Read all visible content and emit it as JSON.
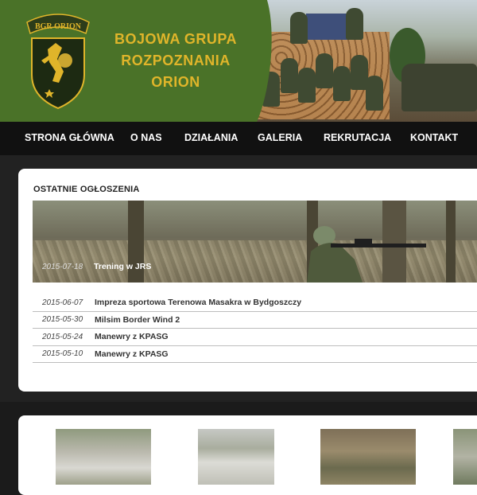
{
  "header": {
    "badge_text": "BGR ORION",
    "title_lines": [
      "BOJOWA GRUPA",
      "ROZPOZNANIA",
      "ORION"
    ]
  },
  "nav": {
    "items": [
      "STRONA GŁÓWNA",
      "O NAS",
      "DZIAŁANIA",
      "GALERIA",
      "REKRUTACJA",
      "KONTAKT"
    ]
  },
  "announcements": {
    "title": "OSTATNIE OGŁOSZENIA",
    "featured": {
      "date": "2015-07-18",
      "title": "Trening w JRS"
    },
    "items": [
      {
        "date": "2015-06-07",
        "title": "Impreza sportowa Terenowa Masakra w Bydgoszczy"
      },
      {
        "date": "2015-05-30",
        "title": "Milsim Border Wind 2"
      },
      {
        "date": "2015-05-24",
        "title": "Manewry z KPASG"
      },
      {
        "date": "2015-05-10",
        "title": "Manewry z KPASG"
      }
    ]
  },
  "colors": {
    "header_green": "#4a7228",
    "title_gold": "#e0b52a",
    "nav_bg": "#111111",
    "page_bg": "#1b1b1b"
  }
}
